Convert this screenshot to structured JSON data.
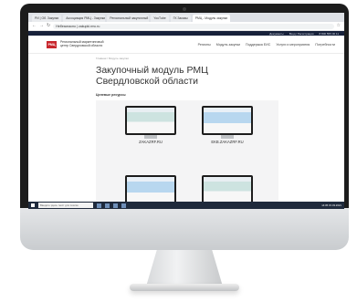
{
  "browser": {
    "tabs": [
      {
        "label": "РИ | Об. Закупки"
      },
      {
        "label": "Ассоциация РМЦ - Закупки"
      },
      {
        "label": "Региональный закупочный"
      },
      {
        "label": "YouTube"
      },
      {
        "label": "ГК Заказы"
      },
      {
        "label": "РМЦ - Модуль закупки",
        "active": true
      }
    ],
    "url": "Небезопасно | zakupki.rmc.ru"
  },
  "site": {
    "topbar": [
      "Документы",
      "Вход / Регистрация",
      "8 800 555 00 11"
    ],
    "logo_text": "РМЦ",
    "org_name": "Региональный маркетинговый центр Свердловской области",
    "menu": [
      "Регионы",
      "Модуль закупки",
      "Поддержка ЕИС",
      "Услуги и мероприятия",
      "Потребности"
    ],
    "breadcrumb": "Главная / Модуль закупки",
    "page_title": "Закупочный модуль РМЦ Свердловской области",
    "section_title": "Целевые ресурсы",
    "resources": [
      {
        "label": "ZAKAZRF.RU"
      },
      {
        "label": "EKB.ZAKAZRF.RU"
      },
      {
        "label": ""
      },
      {
        "label": ""
      }
    ]
  },
  "taskbar": {
    "search_placeholder": "Введите здесь текст для поиска",
    "clock": "14:05 15.03.2021"
  }
}
